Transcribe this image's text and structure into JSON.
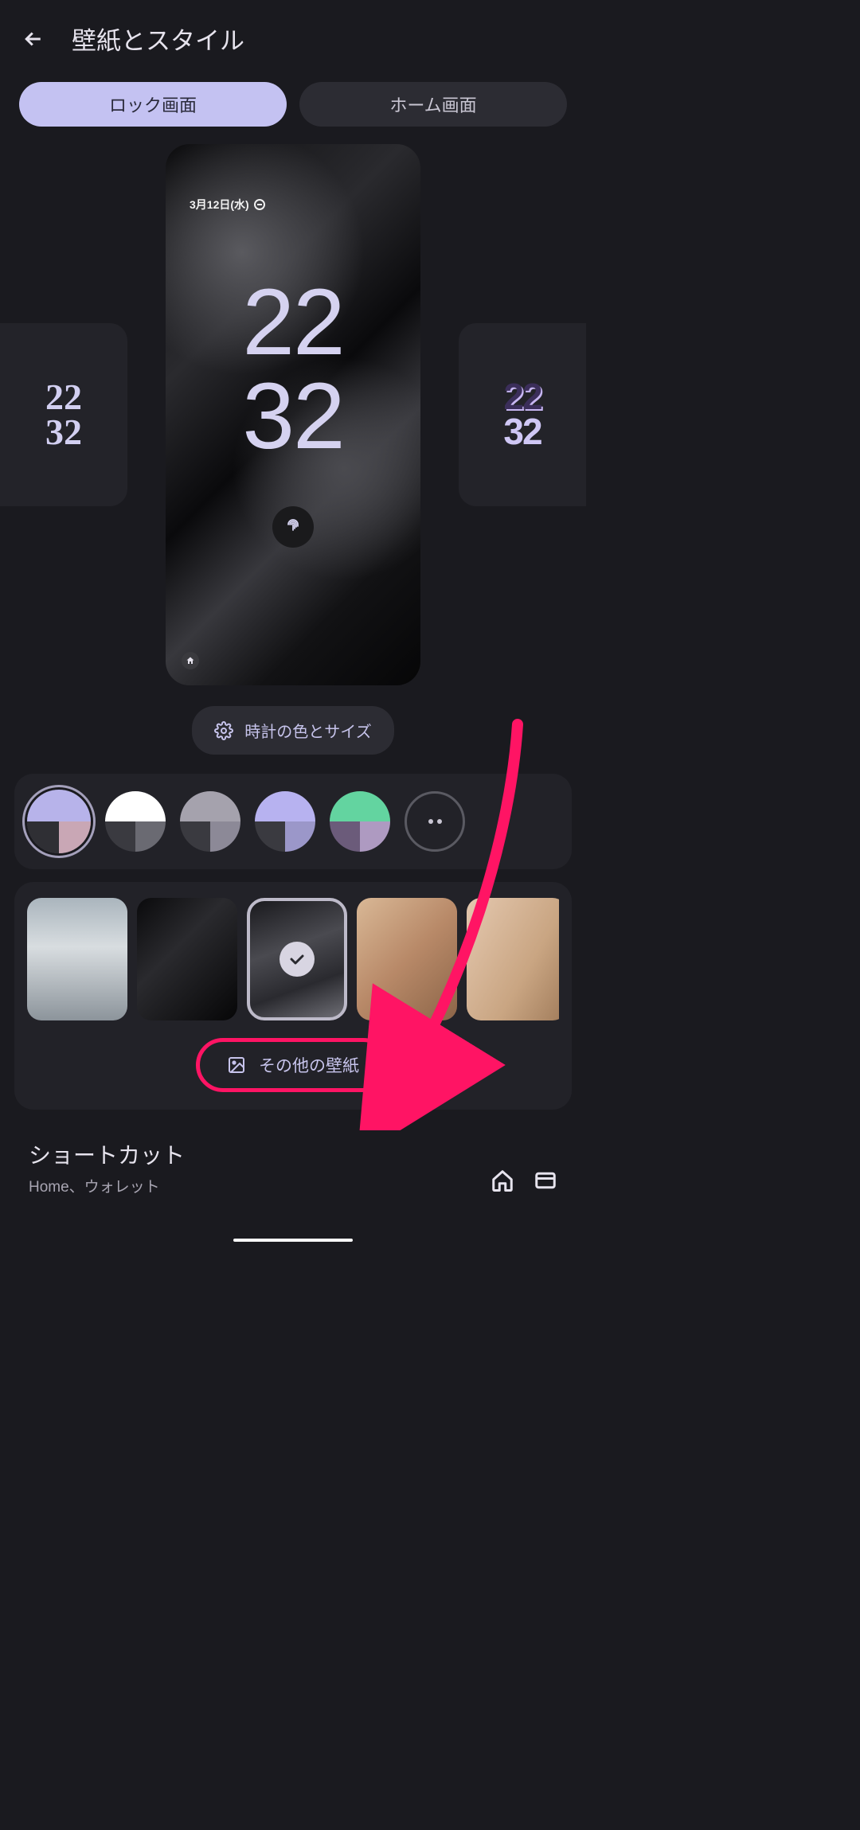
{
  "header": {
    "title": "壁紙とスタイル"
  },
  "tabs": {
    "lock": "ロック画面",
    "home": "ホーム画面"
  },
  "phone_preview": {
    "date": "3月12日(水)",
    "clock_hh": "22",
    "clock_mm": "32"
  },
  "side_clock": {
    "hh": "22",
    "mm": "32"
  },
  "clock_settings_label": "時計の色とサイズ",
  "palettes": [
    {
      "top": "#b7b3ea",
      "bl": "#2f2f34",
      "br": "#c9a7b5",
      "selected": true
    },
    {
      "top": "#ffffff",
      "bl": "#3a3a40",
      "br": "#6a6a72",
      "selected": false
    },
    {
      "top": "#a5a2ad",
      "bl": "#3a3a40",
      "br": "#8c8997",
      "selected": false
    },
    {
      "top": "#b7b2f0",
      "bl": "#3a3a40",
      "br": "#9b97c9",
      "selected": false
    },
    {
      "top": "#63d4a0",
      "bl": "#6b5b7a",
      "br": "#ae9ac1",
      "selected": false
    }
  ],
  "more_wallpaper_label": "その他の壁紙",
  "shortcut": {
    "title": "ショートカット",
    "subtitle": "Home、ウォレット"
  }
}
